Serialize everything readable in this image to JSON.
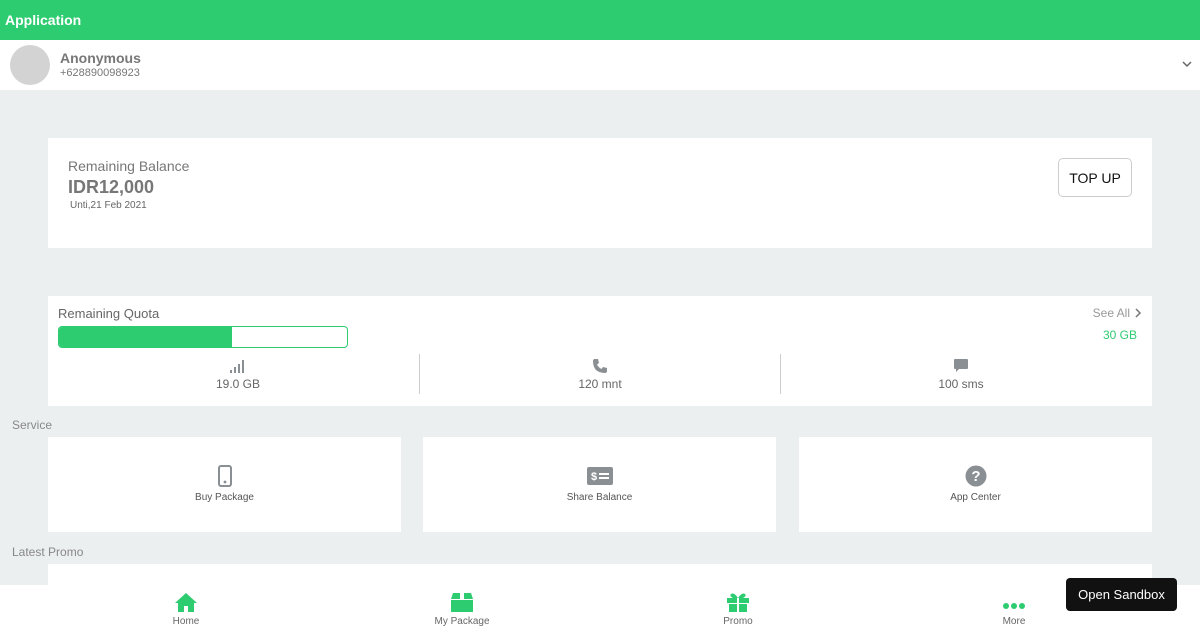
{
  "app": {
    "title": "Application"
  },
  "profile": {
    "name": "Anonymous",
    "phone": "+628890098923"
  },
  "balance": {
    "label": "Remaining Balance",
    "value": "IDR12,000",
    "until": "Unti,21 Feb 2021",
    "topup_label": "TOP UP"
  },
  "quota": {
    "label": "Remaining Quota",
    "see_all": "See All",
    "total": "30 GB",
    "progress_fraction": 0.6,
    "data": "19.0 GB",
    "voice": "120 mnt",
    "sms": "100 sms"
  },
  "service": {
    "label": "Service",
    "items": [
      {
        "label": "Buy Package",
        "icon": "phone-icon"
      },
      {
        "label": "Share Balance",
        "icon": "money-icon"
      },
      {
        "label": "App Center",
        "icon": "question-icon"
      }
    ]
  },
  "promo": {
    "label": "Latest Promo"
  },
  "nav": {
    "items": [
      {
        "label": "Home",
        "icon": "home-icon"
      },
      {
        "label": "My Package",
        "icon": "box-icon"
      },
      {
        "label": "Promo",
        "icon": "gift-icon"
      },
      {
        "label": "More",
        "icon": "more-icon"
      }
    ]
  },
  "sandbox": {
    "label": "Open Sandbox"
  },
  "colors": {
    "accent": "#2ecc71",
    "background": "#eceff0",
    "icon_gray": "#8a8f93"
  }
}
